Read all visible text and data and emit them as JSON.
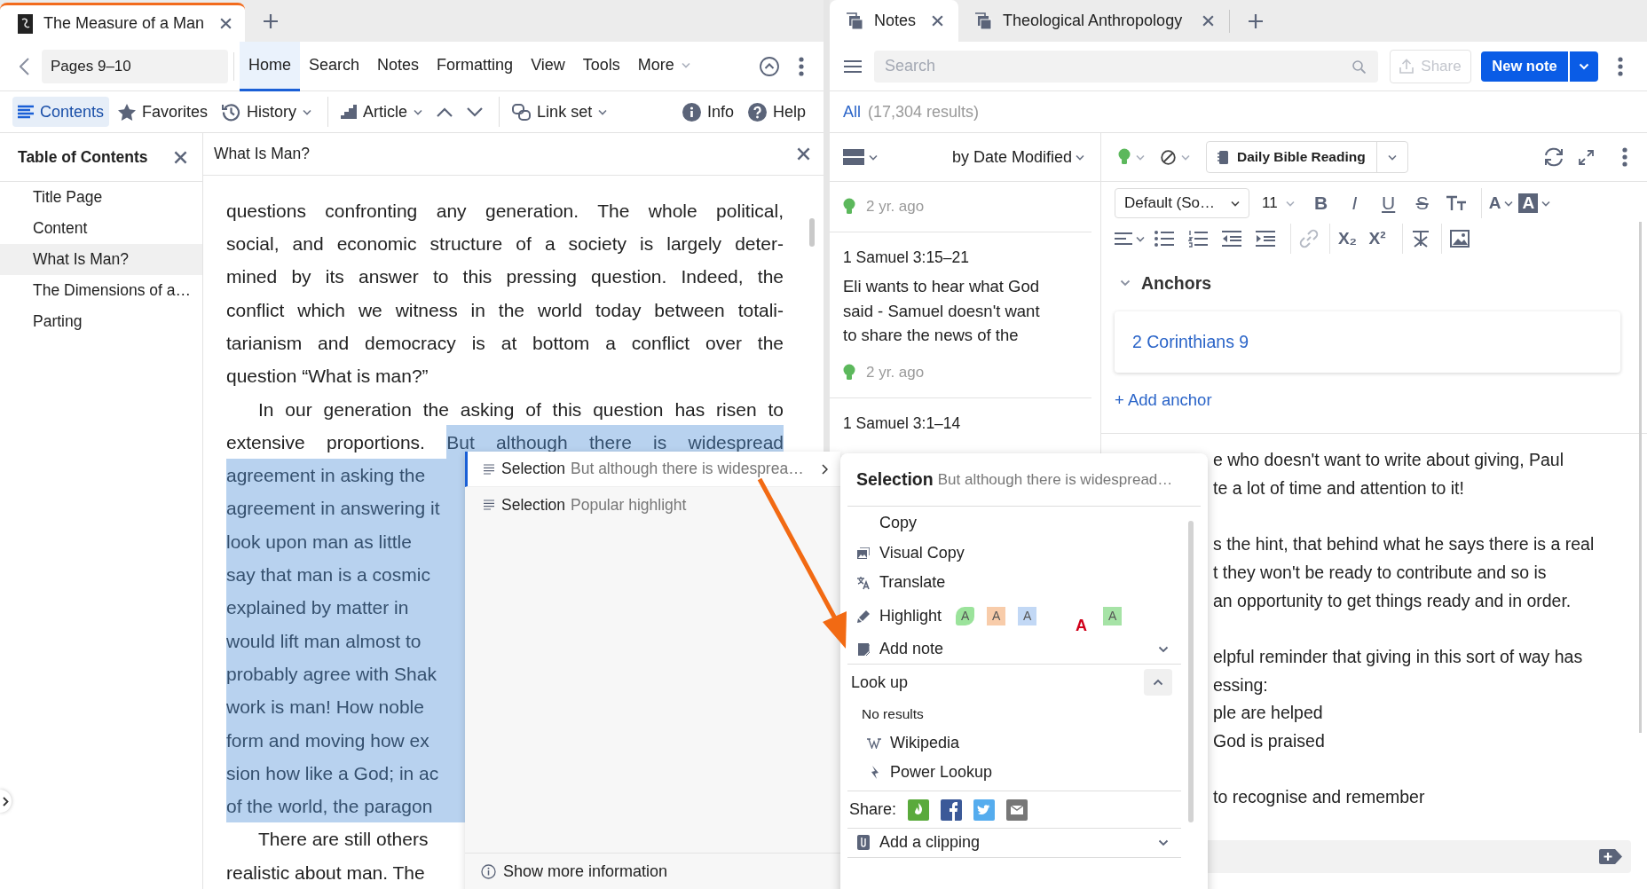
{
  "reader_window": {
    "tab": {
      "title": "The Measure of a Man"
    },
    "location": "Pages 9–10",
    "menu": [
      {
        "label": "Home",
        "selected": true,
        "has_menu": false
      },
      {
        "label": "Search",
        "selected": false,
        "has_menu": false
      },
      {
        "label": "Notes",
        "selected": false,
        "has_menu": false
      },
      {
        "label": "Formatting",
        "selected": false,
        "has_menu": false
      },
      {
        "label": "View",
        "selected": false,
        "has_menu": false
      },
      {
        "label": "Tools",
        "selected": false,
        "has_menu": false
      },
      {
        "label": "More",
        "selected": false,
        "has_menu": true
      }
    ],
    "toolbar": [
      {
        "kind": "contents",
        "label": "Contents",
        "selected": true,
        "has_menu": false,
        "separator_before": false
      },
      {
        "kind": "favorites",
        "label": "Favorites",
        "selected": false,
        "has_menu": false,
        "separator_before": false
      },
      {
        "kind": "history",
        "label": "History",
        "selected": false,
        "has_menu": true,
        "separator_before": false
      },
      {
        "kind": "article",
        "label": "Article",
        "selected": false,
        "has_menu": true,
        "separator_before": true
      },
      {
        "kind": "previous",
        "selected": false,
        "has_menu": false,
        "separator_before": false
      },
      {
        "kind": "next",
        "selected": false,
        "has_menu": false,
        "separator_before": false
      },
      {
        "kind": "link_set",
        "label": "Link set",
        "selected": false,
        "has_menu": true,
        "separator_before": true
      },
      {
        "kind": "info",
        "label": "Info",
        "selected": false,
        "has_menu": false,
        "separator_before": false
      },
      {
        "kind": "help",
        "label": "Help",
        "selected": false,
        "has_menu": false,
        "separator_before": false
      }
    ],
    "toc": {
      "title": "Table of Contents",
      "items": [
        {
          "label": "Title Page",
          "selected": false
        },
        {
          "label": "Content",
          "selected": false
        },
        {
          "label": "What Is Man?",
          "selected": true
        },
        {
          "label": "The Dimensions of a…",
          "selected": false
        },
        {
          "label": "Parting",
          "selected": false
        }
      ]
    },
    "reader": {
      "title": "What Is Man?",
      "lines": [
        {
          "kind": "full",
          "indent": false,
          "parts": [
            {
              "text": "questions confronting any generation. The whole political,",
              "highlighted": false
            }
          ]
        },
        {
          "kind": "full",
          "indent": false,
          "parts": [
            {
              "text": "social, and economic structure of a society is largely deter-",
              "highlighted": false
            }
          ]
        },
        {
          "kind": "full",
          "indent": false,
          "parts": [
            {
              "text": "mined by its answer to this pressing question. Indeed, the",
              "highlighted": false
            }
          ]
        },
        {
          "kind": "full",
          "indent": false,
          "parts": [
            {
              "text": "conflict which we witness in the world today between totali-",
              "highlighted": false
            }
          ]
        },
        {
          "kind": "full",
          "indent": false,
          "parts": [
            {
              "text": "tarianism and democracy is at bottom a conflict over the",
              "highlighted": false
            }
          ]
        },
        {
          "kind": "end",
          "indent": false,
          "parts": [
            {
              "text": "question “What is man?”",
              "highlighted": false
            }
          ]
        },
        {
          "kind": "full",
          "indent": true,
          "parts": [
            {
              "text": "In our generation the asking of this question has risen to",
              "highlighted": false
            }
          ]
        },
        {
          "kind": "full",
          "indent": false,
          "parts": [
            {
              "text": "extensive proportions.",
              "highlighted": false
            },
            {
              "text": "But although there is widespread",
              "highlighted": true
            }
          ]
        },
        {
          "kind": "cut",
          "indent": false,
          "parts": [
            {
              "text": "agreement in asking the",
              "highlighted": true
            }
          ]
        },
        {
          "kind": "cut",
          "indent": false,
          "parts": [
            {
              "text": "agreement in answering it",
              "highlighted": true
            }
          ]
        },
        {
          "kind": "cut",
          "indent": false,
          "parts": [
            {
              "text": "look upon man as little",
              "highlighted": true
            }
          ]
        },
        {
          "kind": "cut",
          "indent": false,
          "parts": [
            {
              "text": "say that man is a cosmic",
              "highlighted": true
            }
          ]
        },
        {
          "kind": "cut",
          "indent": false,
          "parts": [
            {
              "text": "explained by matter in",
              "highlighted": true
            }
          ]
        },
        {
          "kind": "cut",
          "indent": false,
          "parts": [
            {
              "text": "would lift man almost to",
              "highlighted": true
            }
          ]
        },
        {
          "kind": "cut",
          "indent": false,
          "parts": [
            {
              "text": "probably agree with Shak",
              "highlighted": true
            }
          ]
        },
        {
          "kind": "cut",
          "indent": false,
          "parts": [
            {
              "text": "work is man! How noble",
              "highlighted": true
            }
          ]
        },
        {
          "kind": "cut",
          "indent": false,
          "parts": [
            {
              "text": "form and moving how ex",
              "highlighted": true
            }
          ]
        },
        {
          "kind": "cut",
          "indent": false,
          "parts": [
            {
              "text": "sion how like a God; in ac",
              "highlighted": true
            }
          ]
        },
        {
          "kind": "cut",
          "indent": false,
          "parts": [
            {
              "text": "of the world, the paragon",
              "highlighted": true
            }
          ]
        },
        {
          "kind": "cut",
          "indent": true,
          "parts": [
            {
              "text": "There are still others",
              "highlighted": false
            }
          ]
        },
        {
          "kind": "cut",
          "indent": false,
          "parts": [
            {
              "text": "realistic about man. The",
              "highlighted": false
            }
          ]
        }
      ]
    }
  },
  "selection_panel": {
    "results": [
      {
        "label": "Selection",
        "text": "But although there is widesprea…",
        "selected": true
      },
      {
        "label": "Selection",
        "text": "Popular highlight",
        "selected": false
      }
    ],
    "footer": "Show more information"
  },
  "context_menu": {
    "title": "Selection",
    "subtitle": "But although there is widespread…",
    "items": [
      {
        "kind": "copy",
        "label": "Copy"
      },
      {
        "kind": "visual_copy",
        "label": "Visual Copy"
      },
      {
        "kind": "translate",
        "label": "Translate"
      },
      {
        "kind": "highlight",
        "label": "Highlight",
        "swatches": [
          {
            "kind": "brush",
            "label": "A",
            "color": "#9be39b"
          },
          {
            "kind": "fill",
            "label": "A",
            "color": "#f8ccaa"
          },
          {
            "kind": "fill",
            "label": "A",
            "color": "#c2d8f5"
          },
          {
            "kind": "text",
            "label": "A",
            "color": "#d0021b"
          },
          {
            "kind": "fill",
            "label": "A",
            "color": "#a6e3a6"
          }
        ]
      },
      {
        "kind": "add_note",
        "label": "Add note",
        "expanded": false
      },
      {
        "kind": "section",
        "label": "Look up",
        "expanded": true
      },
      {
        "kind": "empty",
        "label": "No results"
      },
      {
        "kind": "wikipedia",
        "label": "Wikipedia"
      },
      {
        "kind": "power_lookup",
        "label": "Power Lookup"
      },
      {
        "kind": "share",
        "label": "Share:"
      },
      {
        "kind": "clipping",
        "label": "Add a clipping",
        "expanded": false
      }
    ]
  },
  "notes_window": {
    "tabs": [
      {
        "title": "Notes",
        "selected": true
      },
      {
        "title": "Theological Anthropology",
        "selected": false
      }
    ],
    "search": {
      "placeholder": "Search"
    },
    "share_button": {
      "label": "Share",
      "disabled": true
    },
    "new_note_button": "New note",
    "filter": {
      "label": "All",
      "count": "(17,304 results)"
    },
    "sort": "by Date Modified",
    "notes": [
      {
        "time": "2 yr. ago"
      },
      {
        "reference": "1 Samuel 3:15–21",
        "text": "Eli wants to hear what God said - Samuel doesn't want to share the news of the",
        "time": "2 yr. ago"
      },
      {
        "reference": "1 Samuel 3:1–14"
      }
    ],
    "editor": {
      "notebook": "Daily Bible Reading",
      "font": "Default (So…",
      "font_size": "11",
      "format_rows": [
        [
          {
            "kind": "bold",
            "label": "B",
            "separator_before": false,
            "disabled": false,
            "has_menu": false
          },
          {
            "kind": "italic",
            "label": "I",
            "separator_before": false,
            "disabled": false,
            "has_menu": false
          },
          {
            "kind": "underline",
            "label": "U",
            "separator_before": false,
            "disabled": false,
            "has_menu": false
          },
          {
            "kind": "strike",
            "label": "S",
            "separator_before": false,
            "disabled": false,
            "has_menu": false
          },
          {
            "kind": "size",
            "separator_before": false,
            "disabled": false,
            "has_menu": false
          },
          {
            "kind": "color",
            "label": "A",
            "separator_before": true,
            "disabled": false,
            "has_menu": true
          },
          {
            "kind": "highlight",
            "label": "A",
            "separator_before": false,
            "disabled": false,
            "has_menu": true
          }
        ],
        [
          {
            "kind": "align",
            "separator_before": false,
            "disabled": false,
            "has_menu": true
          },
          {
            "kind": "bullets",
            "separator_before": false,
            "disabled": false,
            "has_menu": false
          },
          {
            "kind": "numbers",
            "separator_before": false,
            "disabled": false,
            "has_menu": false
          },
          {
            "kind": "outdent",
            "separator_before": false,
            "disabled": false,
            "has_menu": false
          },
          {
            "kind": "indent",
            "separator_before": false,
            "disabled": false,
            "has_menu": false
          },
          {
            "kind": "link",
            "separator_before": true,
            "disabled": true,
            "has_menu": false
          },
          {
            "kind": "subscript",
            "label": "X₂",
            "separator_before": true,
            "disabled": false,
            "has_menu": false
          },
          {
            "kind": "superscript",
            "label": "X²",
            "separator_before": false,
            "disabled": false,
            "has_menu": false
          },
          {
            "kind": "clear",
            "separator_before": true,
            "disabled": false,
            "has_menu": false
          },
          {
            "kind": "image",
            "separator_before": true,
            "disabled": false,
            "has_menu": false
          }
        ]
      ],
      "anchors": {
        "title": "Anchors",
        "expanded": true,
        "items": [
          "2 Corinthians 9"
        ],
        "add_label": "+ Add anchor"
      },
      "body": [
        {
          "text": "e who doesn't want to write about giving, Paul",
          "gap_before": false
        },
        {
          "text": "te a lot of time and attention to it!",
          "gap_before": false
        },
        {
          "text": "s the hint, that behind what he says there is a real",
          "gap_before": true
        },
        {
          "text": "t they won't be ready to contribute and so is",
          "gap_before": false
        },
        {
          "text": "an opportunity to get things ready and in order.",
          "gap_before": false
        },
        {
          "text": "elpful reminder that giving in this sort of way has",
          "gap_before": true
        },
        {
          "text": "essing:",
          "gap_before": false
        },
        {
          "text": "ple are helped",
          "gap_before": false
        },
        {
          "text": "God is praised",
          "gap_before": false
        },
        {
          "text": "to recognise and remember",
          "gap_before": true
        }
      ]
    }
  }
}
